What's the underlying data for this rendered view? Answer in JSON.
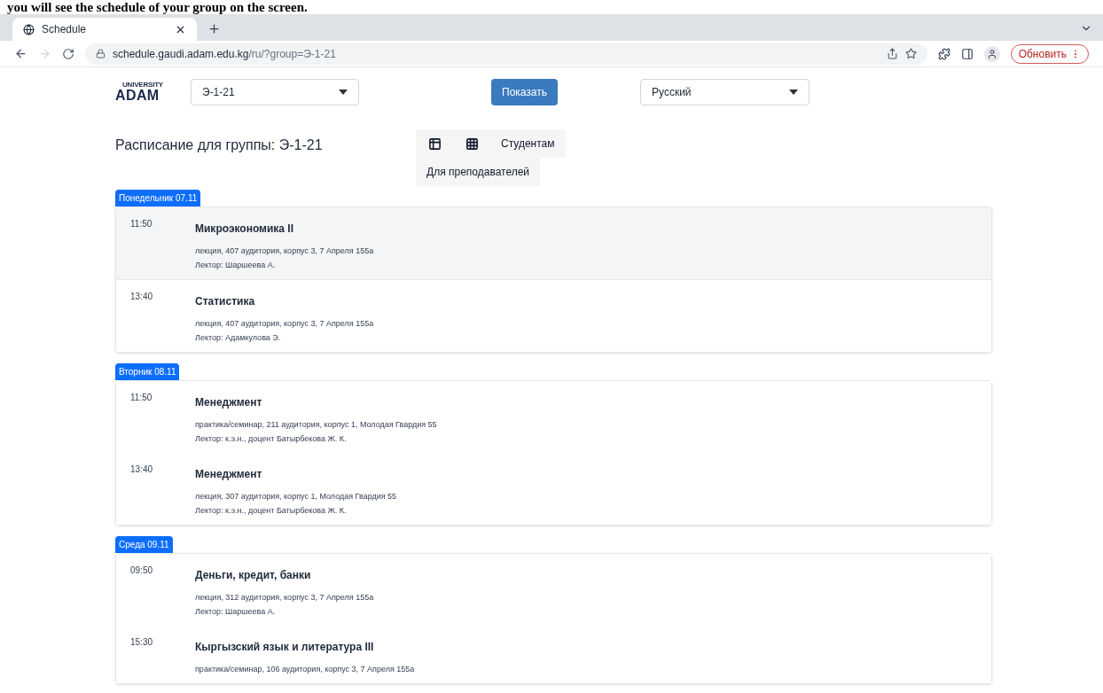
{
  "document_text": "you will see the schedule of your group on the screen.",
  "browser": {
    "tab_title": "Schedule",
    "url_host": "schedule.gaudi.adam.edu.kg",
    "url_path": "/ru/?group=Э-1-21",
    "update_button": "Обновить"
  },
  "header": {
    "logo_top": "UNIVERSITY",
    "logo_bottom": "ADAM",
    "group_select": "Э-1-21",
    "show_button": "Показать",
    "language_select": "Русский"
  },
  "title": "Расписание для группы: Э-1-21",
  "view_buttons": [
    {
      "kind": "list"
    },
    {
      "kind": "grid"
    },
    {
      "kind": "text",
      "label": "Студентам"
    },
    {
      "kind": "text",
      "label": "Для преподавателей"
    }
  ],
  "days": [
    {
      "label": "Понедельник 07.11",
      "lessons": [
        {
          "time": "11:50",
          "subject": "Микроэкономика II",
          "details": "лекция, 407 аудитория, корпус 3, 7 Апреля 155а",
          "lecturer": "Лектор: Шаршеева А.",
          "highlighted": true
        },
        {
          "time": "13:40",
          "subject": "Статистика",
          "details": "лекция, 407 аудитория, корпус 3, 7 Апреля 155а",
          "lecturer": "Лектор: Адамкулова Э.",
          "highlighted": false
        }
      ]
    },
    {
      "label": "Вторник 08.11",
      "lessons": [
        {
          "time": "11:50",
          "subject": "Менеджмент",
          "details": "практика/семинар, 211 аудитория, корпус 1, Молодая Гвардия 55",
          "lecturer": "Лектор: к.э.н., доцент Батырбекова Ж. К.",
          "highlighted": false
        },
        {
          "time": "13:40",
          "subject": "Менеджмент",
          "details": "лекция, 307 аудитория, корпус 1, Молодая Гвардия 55",
          "lecturer": "Лектор: к.э.н., доцент Батырбекова Ж. К.",
          "highlighted": false
        }
      ]
    },
    {
      "label": "Среда 09.11",
      "lessons": [
        {
          "time": "09:50",
          "subject": "Деньги, кредит, банки",
          "details": "лекция, 312 аудитория, корпус 3, 7 Апреля 155а",
          "lecturer": "Лектор: Шаршеева А.",
          "highlighted": false
        },
        {
          "time": "15:30",
          "subject": "Кыргызский язык и литература III",
          "details": "практика/семинар, 106 аудитория, корпус 3, 7 Апреля 155а",
          "highlighted": false
        }
      ]
    }
  ]
}
